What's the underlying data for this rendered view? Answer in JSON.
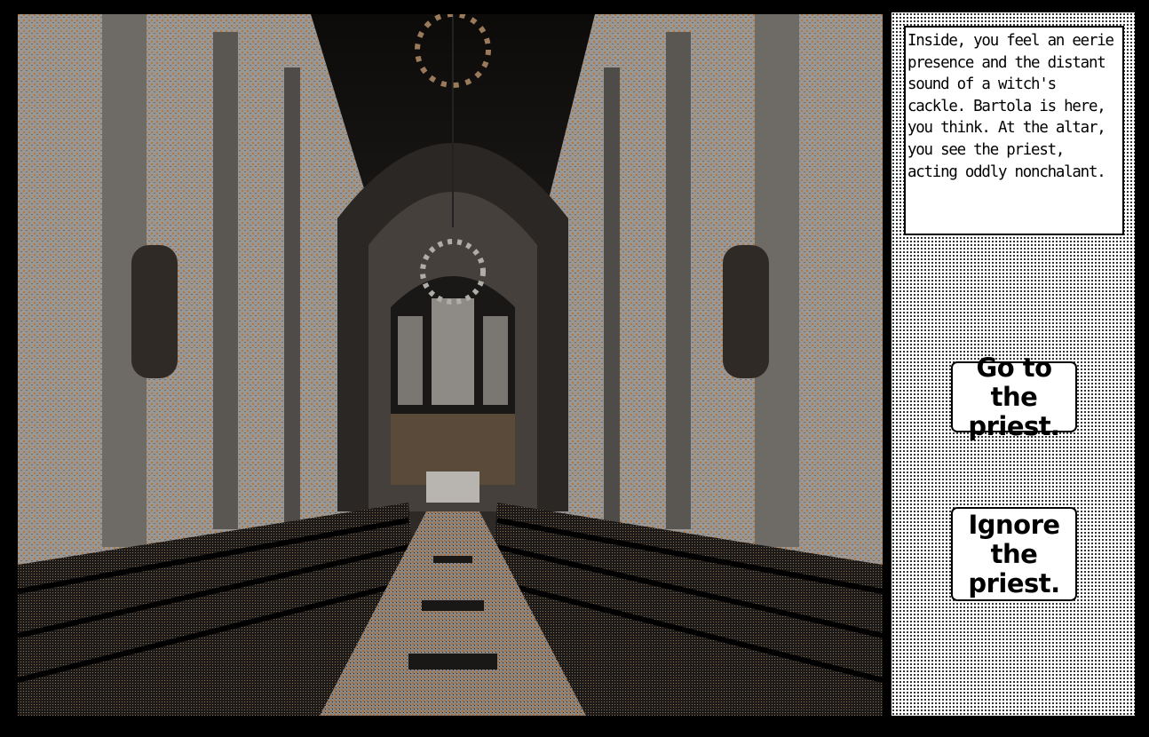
{
  "game": {
    "narration": "Inside, you feel an eerie presence and the distant sound of a witch's cackle. Bartola is here, you think. At the altar, you see the priest, acting oddly nonchalant.",
    "choices": [
      {
        "label": "Go to the priest."
      },
      {
        "label": "Ignore the priest."
      }
    ]
  },
  "colors": {
    "background": "#000000",
    "panel": "#ffffff",
    "dither": "#000000",
    "scene_gray": "#8c8c8c",
    "scene_copper": "#a0703f",
    "scene_dark": "#1e1c1a"
  },
  "scene": {
    "description_icon": "church-interior-scene"
  }
}
